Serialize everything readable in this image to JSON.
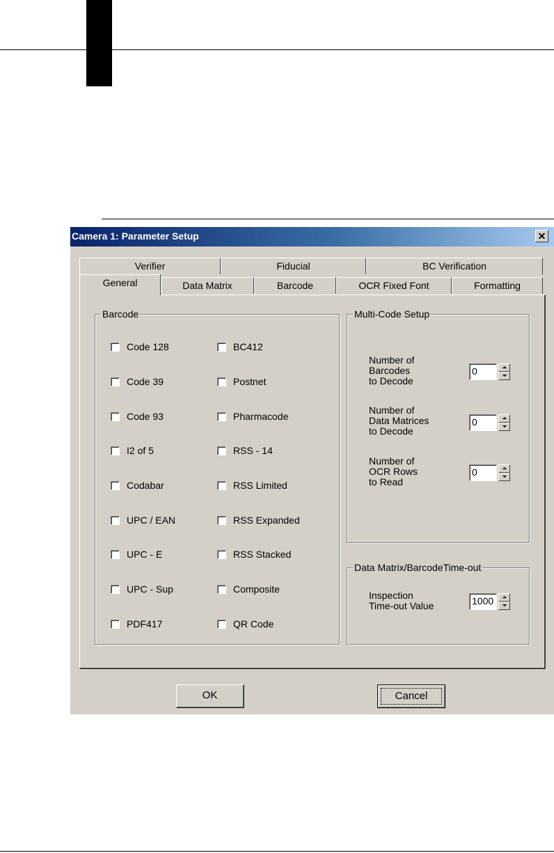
{
  "dialog": {
    "title": "Camera 1: Parameter Setup",
    "close_glyph": "✕"
  },
  "tabs": {
    "row_back": [
      "Verifier",
      "Fiducial",
      "BC Verification"
    ],
    "row_front": [
      "General",
      "Data Matrix",
      "Barcode",
      "OCR Fixed Font",
      "Formatting"
    ],
    "active": "General"
  },
  "barcode_group": {
    "title": "Barcode",
    "left_column": [
      "Code 128",
      "Code 39",
      "Code 93",
      "I2 of 5",
      "Codabar",
      "UPC / EAN",
      "UPC - E",
      "UPC - Sup",
      "PDF417"
    ],
    "right_column": [
      "BC412",
      "Postnet",
      "Pharmacode",
      "RSS - 14",
      "RSS Limited",
      "RSS Expanded",
      "RSS Stacked",
      "Composite",
      "QR Code"
    ],
    "all_checked": false
  },
  "multicode_group": {
    "title": "Multi-Code Setup",
    "fields": [
      {
        "label_lines": [
          "Number of",
          "Barcodes",
          "to Decode"
        ],
        "value": "0"
      },
      {
        "label_lines": [
          "Number of",
          "Data Matrices",
          "to Decode"
        ],
        "value": "0"
      },
      {
        "label_lines": [
          "Number of",
          "OCR Rows",
          "to Read"
        ],
        "value": "0"
      }
    ]
  },
  "timeout_group": {
    "title": "Data Matrix/BarcodeTime-out",
    "label_lines": [
      "Inspection",
      "Time-out Value"
    ],
    "value": "1000"
  },
  "buttons": {
    "ok": "OK",
    "cancel": "Cancel"
  },
  "colors": {
    "dialog_face": "#d4d0c8",
    "titlebar_start": "#0a246a",
    "titlebar_end": "#a6caf0"
  }
}
